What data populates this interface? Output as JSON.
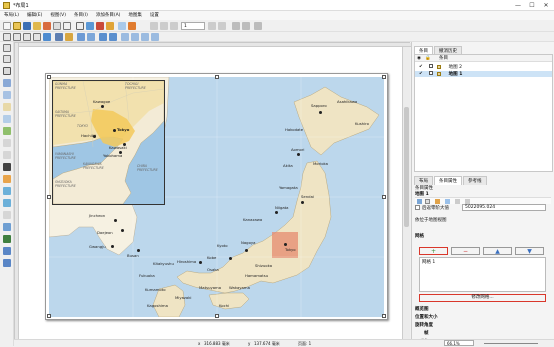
{
  "window": {
    "title": "*布局1",
    "minimize": "—",
    "maximize": "☐",
    "close": "✕"
  },
  "menu": [
    "布局(L)",
    "编辑(E)",
    "视图(V)",
    "条目(I)",
    "添加条目(A)",
    "地图集",
    "设置"
  ],
  "toolbar": {
    "page_value": "1"
  },
  "map": {
    "inset_labels": [
      {
        "text": "GUNMA\nPREFECTURE",
        "cls": "pref"
      },
      {
        "text": "TOCHIGI\nPREFECTURE",
        "cls": "pref"
      },
      {
        "text": "SAITAMA\nPREFECTURE",
        "cls": "pref"
      },
      {
        "text": "YAMANASHI\nPREFECTURE",
        "cls": "pref"
      },
      {
        "text": "TOKYO",
        "cls": "pref"
      },
      {
        "text": "KANAGAWA\nPREFECTURE",
        "cls": "pref"
      },
      {
        "text": "SHIZUOKA\nPREFECTURE",
        "cls": "pref"
      },
      {
        "text": "CHIBA\nPREFECTURE",
        "cls": "pref"
      },
      {
        "text": "Kawagoe",
        "cls": "lbl"
      },
      {
        "text": "Tokyo",
        "cls": "lbl"
      },
      {
        "text": "Hachiōji",
        "cls": "lbl"
      },
      {
        "text": "Kawasaki",
        "cls": "lbl"
      },
      {
        "text": "Yokohama",
        "cls": "lbl"
      }
    ],
    "main_labels": [
      "Jincheon",
      "Daejeon",
      "Gwangju",
      "Busan",
      "Fukuoka",
      "Kitakyushu",
      "Hiroshima",
      "Kobe",
      "Osaka",
      "Kyoto",
      "Nagoya",
      "Kanazawa",
      "Niigata",
      "Sendai",
      "Tokyo",
      "Aomori",
      "Sapporo",
      "Asahikawa",
      "Kushiro",
      "Hakodate",
      "Akita",
      "Morioka",
      "Yamagata",
      "Kagoshima",
      "Kumamoto",
      "Miyazaki",
      "Matsuyama",
      "Kochi",
      "Wakayama",
      "Shizuoka",
      "Hamamatsu"
    ]
  },
  "status": {
    "x_label": "x",
    "x_value": "316.883 毫米",
    "y_label": "y",
    "y_value": "137.674 毫米",
    "page_label": "页面: 1",
    "zoom_value": "66.1%"
  },
  "panel": {
    "top_tabs": [
      "条目",
      "撤消历史"
    ],
    "items_header": "条目",
    "layers": [
      {
        "label": "地图 2",
        "checked": true
      },
      {
        "label": "地图 1",
        "checked": true
      }
    ],
    "mid_tabs": [
      "布局",
      "条目属性",
      "参考线"
    ],
    "props_title": "条目属性",
    "item_name": "地图 1",
    "atlas_label": "后返零阶大值",
    "atlas_value": "5022095.024",
    "section_snap": "依位于地图视图",
    "section_grid": "网格",
    "grid_add": "+",
    "grid_remove": "−",
    "grid_up": "▲",
    "grid_down": "▼",
    "grid_item": "网格 1",
    "grid_modify": "修改网格...",
    "sections": [
      "概览图",
      "位置和大小",
      "旋转角度",
      "帧"
    ],
    "color_label": "颜色",
    "thickness_label": "粗度",
    "thickness_value": "0.30",
    "thickness_unit": "毫米"
  },
  "colors": {
    "accent": "#d9372b",
    "land": "#f6f1e2",
    "japan": "#efe4c4",
    "sea": "#bcd7ec",
    "urban": "#f3c95a",
    "highlight": "#e58b6f"
  }
}
